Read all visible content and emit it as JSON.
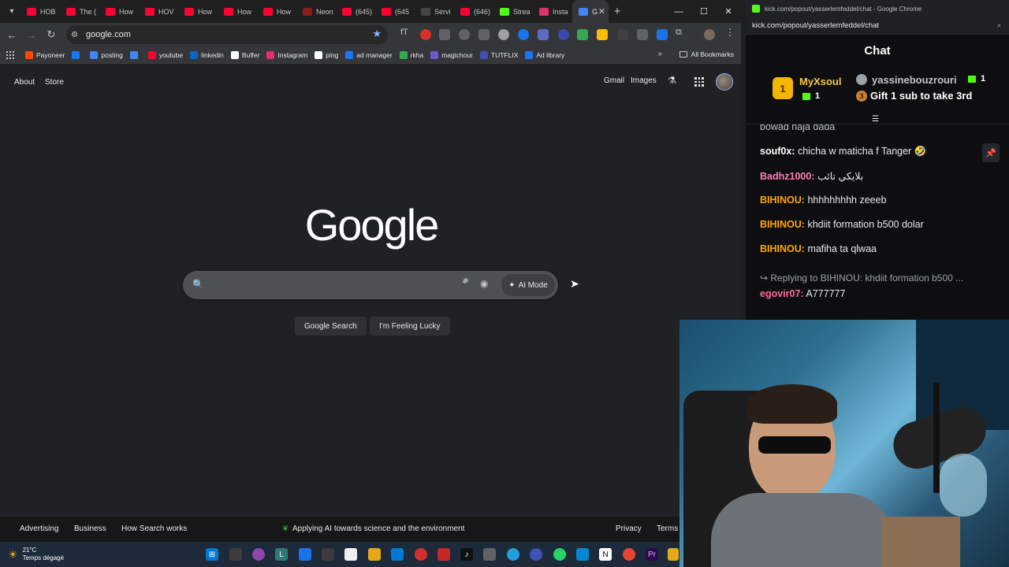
{
  "browser": {
    "tabs": [
      {
        "label": "HOB",
        "color": "#ff0033"
      },
      {
        "label": "The (",
        "color": "#ff0033"
      },
      {
        "label": "How",
        "color": "#ff0033"
      },
      {
        "label": "HOV",
        "color": "#ff0033"
      },
      {
        "label": "How",
        "color": "#ff0033"
      },
      {
        "label": "How",
        "color": "#ff0033"
      },
      {
        "label": "How",
        "color": "#ff0033"
      },
      {
        "label": "Neon",
        "color": "#8b1a1a"
      },
      {
        "label": "(645)",
        "color": "#ff0033"
      },
      {
        "label": "(645",
        "color": "#ff0033"
      },
      {
        "label": "Servi",
        "color": "#444444"
      },
      {
        "label": "(646)",
        "color": "#ff0033"
      },
      {
        "label": "Strea",
        "color": "#53fc18"
      },
      {
        "label": "Insta",
        "color": "#e1306c"
      },
      {
        "label": "G",
        "color": "#4285f4"
      }
    ],
    "url": "google.com",
    "bookmarks": [
      {
        "label": "Payoneer",
        "color": "#ff4800"
      },
      {
        "label": "",
        "color": "#1877f2"
      },
      {
        "label": "posting",
        "color": "#4285f4"
      },
      {
        "label": "",
        "color": "#4285f4"
      },
      {
        "label": "youtube",
        "color": "#ff0033"
      },
      {
        "label": "linkedin",
        "color": "#0a66c2"
      },
      {
        "label": "Buffer",
        "color": "#ffffff"
      },
      {
        "label": "Instagram",
        "color": "#e1306c"
      },
      {
        "label": "ping",
        "color": "#ffffff"
      },
      {
        "label": "ad manager",
        "color": "#1877f2"
      },
      {
        "label": "rkha",
        "color": "#34a853"
      },
      {
        "label": "magichour",
        "color": "#6a5acd"
      },
      {
        "label": "TUTFLIX",
        "color": "#3f51b5"
      },
      {
        "label": "Ad library",
        "color": "#1877f2"
      }
    ],
    "all_bookmarks": "All Bookmarks"
  },
  "google": {
    "about": "About",
    "store": "Store",
    "gmail": "Gmail",
    "images": "Images",
    "logo": "Google",
    "search_placeholder": "",
    "ai_mode": "AI Mode",
    "search_button": "Google Search",
    "lucky_button": "I'm Feeling Lucky",
    "footer": {
      "advertising": "Advertising",
      "business": "Business",
      "how_search": "How Search works",
      "ai_env": "Applying AI towards science and the environment",
      "privacy": "Privacy",
      "terms": "Terms"
    }
  },
  "chat": {
    "window_title": "kick.com/popout/yasserlemfeddel/chat - Google Chrome",
    "url": "kick.com/popout/yasserlemfeddel/chat",
    "header": "Chat",
    "leaderboard": {
      "first_name": "MyXsoul",
      "first_rank": "1",
      "first_count": "1",
      "second_name": "yassinebouzrouri",
      "second_count": "1",
      "third_rank": "3",
      "third_text": "Gift 1 sub to take 3rd"
    },
    "cut_text": "bowad haja dada",
    "messages": [
      {
        "user": "souf0x:",
        "text": "chicha w maticha f Tanger 🤣",
        "color": "#ffffff"
      },
      {
        "user": "Badhz1000:",
        "text": "بلايكي تائب",
        "color": "#ff7eb6"
      },
      {
        "user": "BIHINOU:",
        "text": "hhhhhhhhh zeeeb",
        "color": "#ffa500"
      },
      {
        "user": "BIHINOU:",
        "text": "khdiit formation b500 dolar",
        "color": "#ffa500"
      },
      {
        "user": "BIHINOU:",
        "text": "mafiha ta qlwaa",
        "color": "#ffa500"
      }
    ],
    "reply_text": "Replying to BIHINOU: khdiit formation b500 ...",
    "last_user": "egovir07:",
    "last_text": "A777777",
    "last_color": "#ff6b9a"
  },
  "taskbar": {
    "temperature": "21°C",
    "weather_label": "Temps dégagé"
  }
}
